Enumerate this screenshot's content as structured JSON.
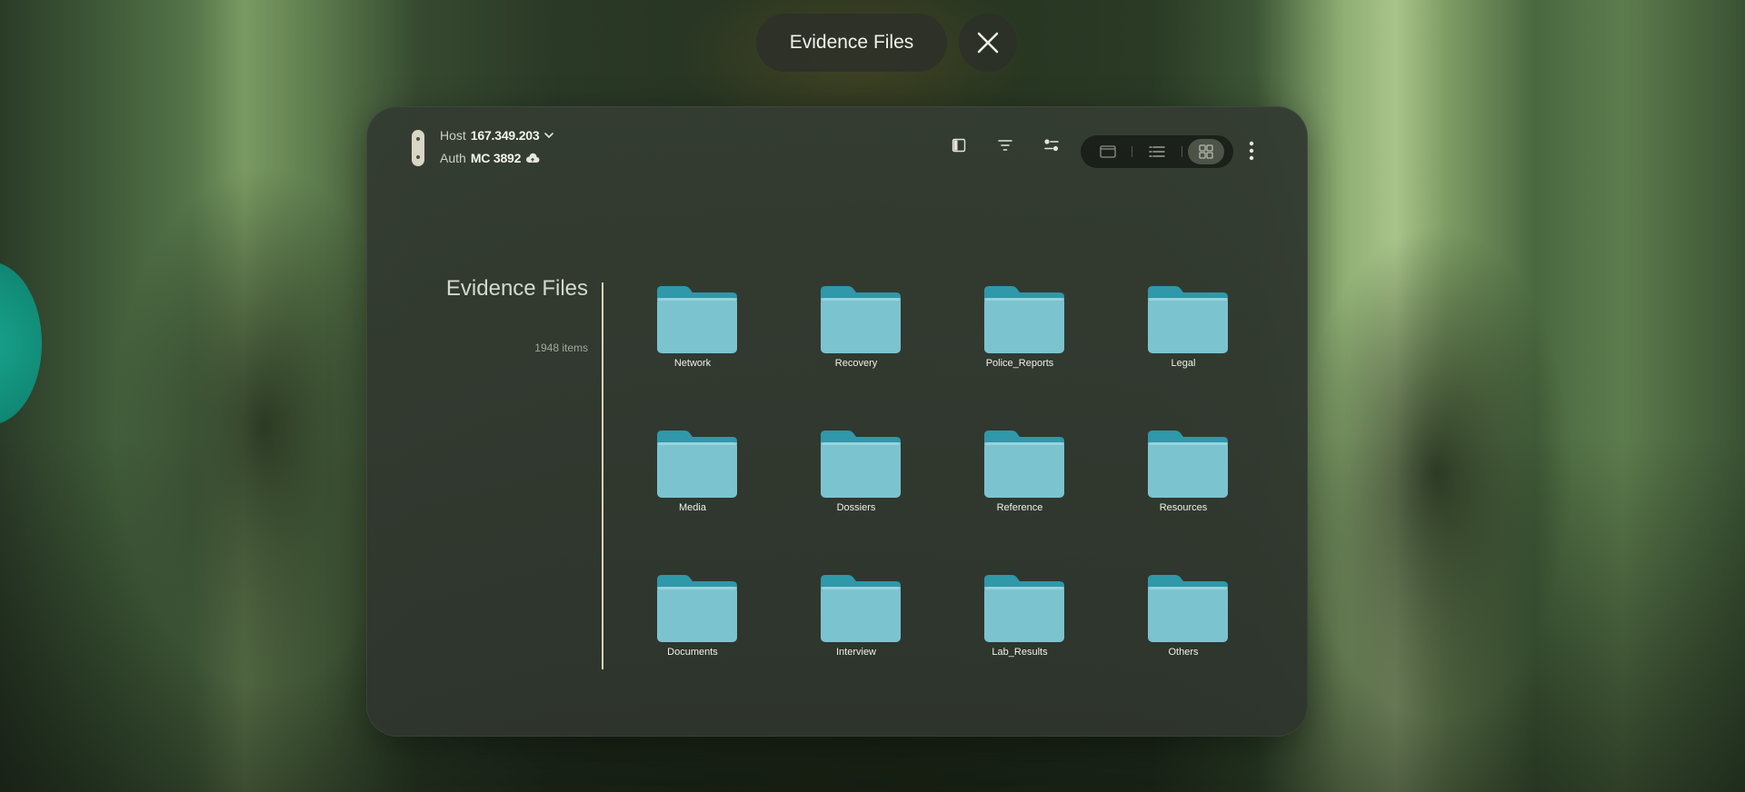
{
  "header": {
    "title": "Evidence Files"
  },
  "toolbar": {
    "host_label": "Host",
    "host_value": "167.349.203",
    "auth_label": "Auth",
    "auth_value": "MC 3892",
    "icons": [
      "sidebar-icon",
      "filter-icon",
      "sliders-icon",
      "window-view-icon",
      "list-view-icon",
      "grid-view-icon",
      "more-vertical-icon"
    ],
    "active_view": "grid"
  },
  "sidebar": {
    "title": "Evidence Files",
    "count": "1948 items"
  },
  "folders": [
    {
      "name": "Network"
    },
    {
      "name": "Recovery"
    },
    {
      "name": "Police_Reports"
    },
    {
      "name": "Legal"
    },
    {
      "name": "Media"
    },
    {
      "name": "Dossiers"
    },
    {
      "name": "Reference"
    },
    {
      "name": "Resources"
    },
    {
      "name": "Documents"
    },
    {
      "name": "Interview"
    },
    {
      "name": "Lab_Results"
    },
    {
      "name": "Others"
    }
  ],
  "colors": {
    "folder_back": "#3a9fae",
    "folder_front": "#7cc3d0",
    "accent_teal": "#12907b"
  }
}
